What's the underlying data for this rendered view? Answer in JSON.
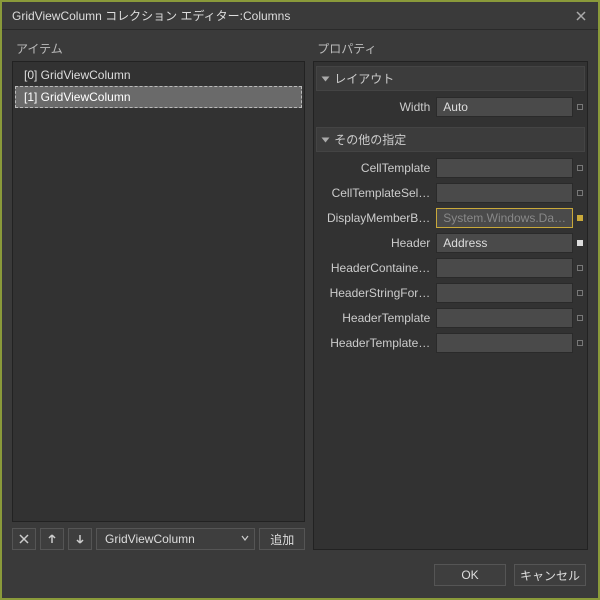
{
  "window": {
    "title": "GridViewColumn  コレクション エディター:Columns"
  },
  "left": {
    "label": "アイテム",
    "items": [
      {
        "label": "[0] GridViewColumn",
        "selected": false
      },
      {
        "label": "[1] GridViewColumn",
        "selected": true
      }
    ],
    "type_dropdown": "GridViewColumn",
    "add_button": "追加"
  },
  "right": {
    "label": "プロパティ",
    "groups": {
      "layout": {
        "title": "レイアウト",
        "props": {
          "width": {
            "label": "Width",
            "value": "Auto"
          }
        }
      },
      "other": {
        "title": "その他の指定",
        "props": {
          "cellTemplate": {
            "label": "CellTemplate",
            "value": ""
          },
          "cellTemplateSelector": {
            "label": "CellTemplateSel…",
            "value": ""
          },
          "displayMemberBinding": {
            "label": "DisplayMemberB…",
            "value": "System.Windows.Da…",
            "placeholder": true,
            "highlighted": true,
            "marker": "yellow"
          },
          "header": {
            "label": "Header",
            "value": "Address",
            "marker": "white"
          },
          "headerContainerStyle": {
            "label": "HeaderContaine…",
            "value": ""
          },
          "headerStringFormat": {
            "label": "HeaderStringFor…",
            "value": ""
          },
          "headerTemplate": {
            "label": "HeaderTemplate",
            "value": ""
          },
          "headerTemplateSelector": {
            "label": "HeaderTemplate…",
            "value": ""
          }
        }
      }
    }
  },
  "footer": {
    "ok": "OK",
    "cancel": "キャンセル"
  }
}
